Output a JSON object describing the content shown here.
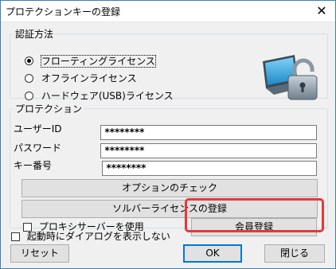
{
  "window": {
    "title": "プロテクションキーの登録",
    "close_symbol": "✕"
  },
  "auth": {
    "legend": "認証方法",
    "options": [
      {
        "label": "フローティングライセンス",
        "checked": true
      },
      {
        "label": "オフラインライセンス",
        "checked": false
      },
      {
        "label": "ハードウェア(USB)ライセンス",
        "checked": false
      }
    ],
    "illustration_icon": "computer-lock-icon"
  },
  "protection": {
    "legend": "プロテクション",
    "user_id_label": "ユーザーID",
    "user_id_value": "********",
    "password_label": "パスワード",
    "password_value": "********",
    "key_label": "キー番号",
    "key_value": "********",
    "check_option_button": "オプションのチェック",
    "solver_license_button": "ソルバーライセンスの登録",
    "proxy_checkbox_label": "プロキシサーバーを使用",
    "member_register_button": "会員登録"
  },
  "footer": {
    "startup_dialog_label": "起動時にダイアログを表示しない",
    "reset_button": "リセット",
    "ok_button": "OK",
    "close_button": "閉じる"
  },
  "colors": {
    "highlight": "#e8373a",
    "accent": "#0078d7"
  }
}
